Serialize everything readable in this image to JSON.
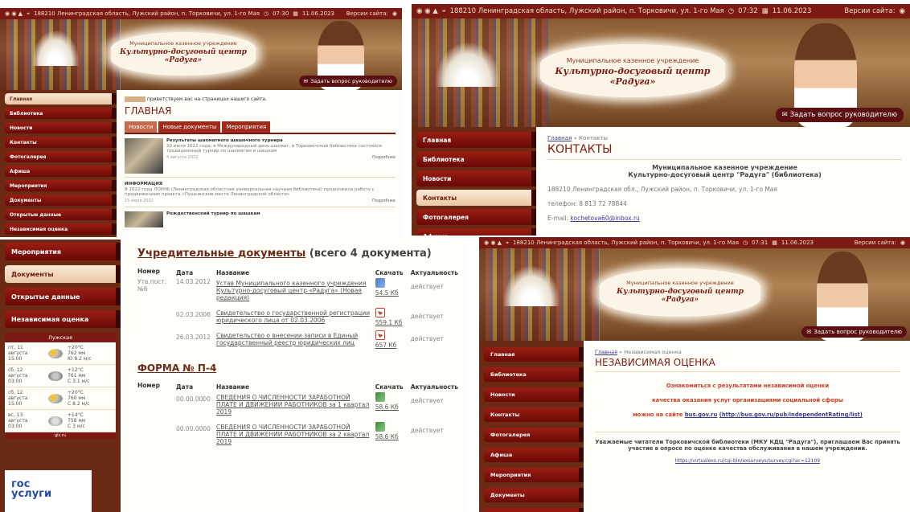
{
  "site": {
    "org_line": "Муниципальное казенное учреждение",
    "org_name": "Культурно-досуговый центр «Радуга»",
    "ask_button": "Задать вопрос руководителю",
    "version_label": "Версии сайта:",
    "colors": {
      "primary": "#7a1a12",
      "sidebar_bg": "#6b2a14",
      "active_item": "#fbe8d4",
      "link": "#3a3a8a",
      "notice": "#c8402a"
    }
  },
  "topbars": {
    "p1": {
      "address": "188210 Ленинградская область, Лужский район, п. Торковичи, ул. 1-го Мая",
      "time": "07:30",
      "date": "11.06.2023"
    },
    "p2": {
      "address": "188210 Ленинградская область, Лужский район, п. Торковичи, ул. 1-го Мая",
      "time": "07:32",
      "date": "11.06.2023"
    },
    "p4": {
      "address": "188210 Ленинградская область, Лужский район, п. Торковичи, ул. 1-го Мая",
      "time": "07:31",
      "date": "11.06.2023"
    }
  },
  "sidebar": {
    "items": [
      "Главная",
      "Библиотека",
      "Новости",
      "Контакты",
      "Фотогалерея",
      "Афиша",
      "Мероприятия",
      "Документы",
      "Открытые данные",
      "Независимая оценка"
    ]
  },
  "home": {
    "welcome_badge": "",
    "welcome": "приветствуем вас на страницах нашего сайта.",
    "title": "ГЛАВНАЯ",
    "tabs": [
      "Новости",
      "Новые документы",
      "Мероприятия"
    ],
    "news": [
      {
        "title": "Результаты шахматного шашечного турнира",
        "text": "20 июля 2022 года, в Международный день шахмат, в Торковичской библиотеке состоялся традиционный турнир по шахматам и шашкам",
        "date": "4 августа 2022",
        "more": "Подробнее"
      },
      {
        "title": "ИНФОРМАЦИЯ",
        "text": "В 2022 году ЛОУНБ (Ленинградская областная универсальная научная библиотека) продолжила работу с продвижением проекта «Пушкинские места Ленинградской области»",
        "date": "15 июля 2022",
        "more": "Подробнее"
      },
      {
        "title": "Рождественский турнир по шашкам",
        "text": "",
        "date": "",
        "more": ""
      }
    ]
  },
  "contacts": {
    "breadcrumb_home": "Главная",
    "breadcrumb_current": "Контакты",
    "title": "КОНТАКТЫ",
    "org_line1": "Муниципальное казенное учреждение",
    "org_line2": "Культурно-досуговый центр \"Радуга\" (библиотека)",
    "address": "188210 Ленинградская обл., Лужский район, п. Торковичи, ул. 1-го Мая",
    "phone": "телефон: 8 813 72 78844",
    "email_label": "E-mail:",
    "email": "kochetova60@inbox.ru"
  },
  "documents": {
    "title_link": "Учредительные документы",
    "title_count": "(всего 4 документа)",
    "headers": [
      "Номер",
      "Дата",
      "Название",
      "Скачать",
      "Актуальность"
    ],
    "rows": [
      {
        "number": "Утв.пост. №6",
        "date": "14.03.2012",
        "name": "Устав Муниципального казенного учреждения Культурно-досуговый центр «Радуга» (Новая редакция)",
        "icon": "doc",
        "size": "54.5 Кб",
        "status": "действует"
      },
      {
        "number": "",
        "date": "02.03.2006",
        "name": "Свидетельство о государственной регистрации юридического лица от 02.03.2006",
        "icon": "pdf",
        "size": "559.1 Кб",
        "status": "действует"
      },
      {
        "number": "",
        "date": "26.03.2012",
        "name": "Свидетельство о внесении записи в Единый государственный реестр юридических лиц",
        "icon": "pdf",
        "size": "657 Кб",
        "status": "действует"
      }
    ],
    "form_title": "ФОРМА № П-4",
    "form_rows": [
      {
        "number": "",
        "date": "00.00.0000",
        "name": "СВЕДЕНИЯ О ЧИСЛЕННОСТИ ЗАРАБОТНОЙ ПЛАТЕ И ДВИЖЕНИИ РАБОТНИКОВ за 1 квартал 2019",
        "icon": "xls",
        "size": "58.6 Кб",
        "status": "действует"
      },
      {
        "number": "",
        "date": "00.00.0000",
        "name": "СВЕДЕНИЯ О ЧИСЛЕННОСТИ ЗАРАБОТНОЙ ПЛАТЕ И ДВИЖЕНИИ РАБОТНИКОВ за 2 квартал 2019",
        "icon": "xls",
        "size": "58.6 Кб",
        "status": "действует"
      }
    ]
  },
  "weather": {
    "title": "Лужская",
    "rows": [
      {
        "day": "пт, 11 августа",
        "time": "15:00",
        "temp": "+20°C",
        "pressure": "762 мм",
        "wind": "Ю 8.2 м/с"
      },
      {
        "day": "сб, 12 августа",
        "time": "03:00",
        "temp": "+12°C",
        "pressure": "761 мм",
        "wind": "С 3.1 м/с"
      },
      {
        "day": "сб, 12 августа",
        "time": "15:00",
        "temp": "+20°C",
        "pressure": "760 мм",
        "wind": "С 8.2 м/с"
      },
      {
        "day": "вс, 13 августа",
        "time": "03:00",
        "temp": "+14°C",
        "pressure": "758 мм",
        "wind": "С 3 м/с"
      }
    ],
    "footer": "gis.ru"
  },
  "gosuslugi": {
    "line1": "гос",
    "line2": "услуги"
  },
  "rating": {
    "breadcrumb_home": "Главная",
    "breadcrumb_current": "Независимая оценка",
    "title": "НЕЗАВИСИМАЯ ОЦЕНКА",
    "line1": "Ознакомиться с результатами независимой оценки",
    "line2": "качества оказания услуг организациями социальной сферы",
    "line3_prefix": "можно на сайте",
    "line3_link1": "bus.gov.ru",
    "line3_link2": "(http://bus.gov.ru/pub/independentRating/list)",
    "survey": "Уважаемые читатели Торковичской библиотеки (МКУ КДЦ \"Радуга\"), приглашаем Вас принять участие в опросе по оценке качества обслуживания в нашем учреждении.",
    "survey_link": "https://virtualexs.ru/cgi-bin/exsurveys/survey.cgi?ac=12109"
  }
}
